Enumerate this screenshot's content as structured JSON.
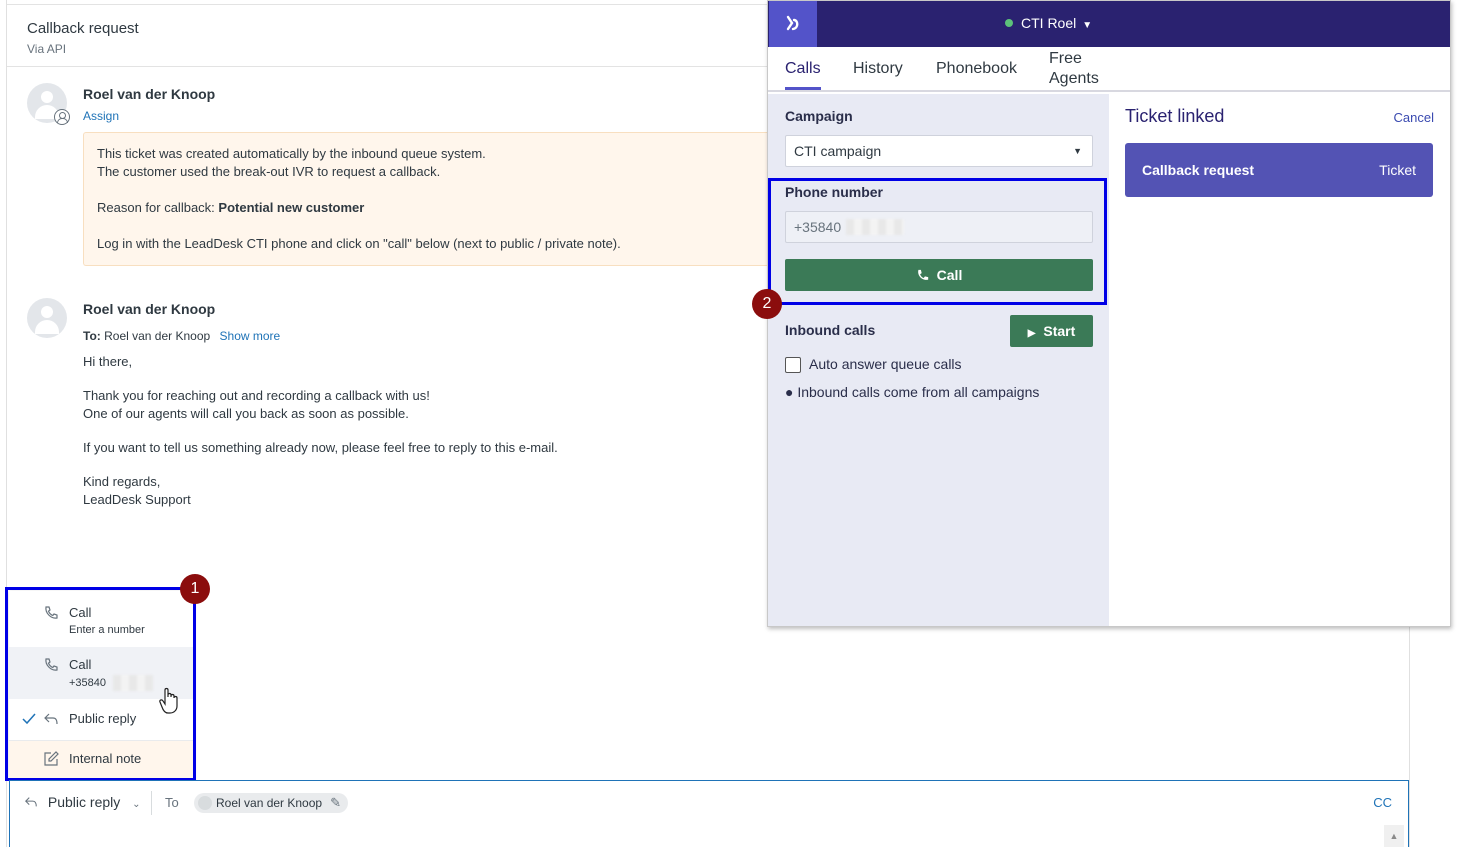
{
  "ticket": {
    "title": "Callback request",
    "subtitle": "Via API"
  },
  "comments": [
    {
      "author": "Roel van der Knoop",
      "assign_label": "Assign",
      "system_lines": [
        "This ticket was created automatically by the inbound queue system.",
        "The customer used the break-out IVR to request a callback.",
        "Reason for callback: ",
        "Potential new customer",
        "Log in with the LeadDesk CTI phone and click on \"call\" below (next to public / private note)."
      ]
    },
    {
      "author": "Roel van der Knoop",
      "to_label": "To:",
      "to_value": "Roel van der Knoop",
      "show_more": "Show more",
      "body": [
        "Hi there,",
        "Thank you for reaching out and recording a callback with us!",
        "One of our agents will call you back as soon as possible.",
        "If you want to tell us something already now, please feel free to reply to this e-mail.",
        "Kind regards,",
        "LeadDesk Support"
      ]
    }
  ],
  "reply_menu": {
    "items": [
      {
        "label": "Call",
        "sub": "Enter a number",
        "icon": "phone-icon"
      },
      {
        "label": "Call",
        "sub": "+35840",
        "icon": "phone-icon"
      },
      {
        "label": "Public reply",
        "icon": "reply-icon",
        "checked": true
      },
      {
        "label": "Internal note",
        "icon": "note-icon"
      }
    ]
  },
  "badges": [
    "1",
    "2"
  ],
  "composer": {
    "mode": "Public reply",
    "to_label": "To",
    "recipient": "Roel van der Knoop",
    "cc": "CC"
  },
  "cti": {
    "user": "CTI Roel",
    "status_color": "#5cc27a",
    "tabs": [
      "Calls",
      "History",
      "Phonebook",
      "Free",
      "Agents"
    ],
    "campaign_label": "Campaign",
    "campaign_value": "CTI campaign",
    "phone_label": "Phone number",
    "phone_value": "+35840",
    "call_button": "Call",
    "inbound_label": "Inbound calls",
    "start_button": "Start",
    "auto_answer_label": "Auto answer queue calls",
    "inbound_note": "● Inbound calls come from all campaigns",
    "linked_title": "Ticket linked",
    "cancel": "Cancel",
    "linked_ticket_name": "Callback request",
    "linked_ticket_type": "Ticket"
  },
  "colors": {
    "cti_header": "#2a2270",
    "cti_accent": "#5353c9",
    "call_green": "#3b7a57",
    "highlight_blue": "#0000e6",
    "badge_red": "#8b0d0d",
    "link_blue": "#1f73b7"
  }
}
